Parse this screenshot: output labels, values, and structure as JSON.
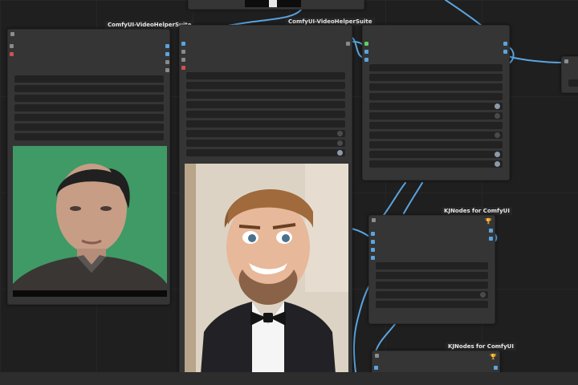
{
  "app": {
    "name": "ComfyUI"
  },
  "nodes": {
    "video_combine_a": {
      "badge": "ComfyUI-VideoHelperSuite"
    },
    "video_combine_b": {
      "badge": "ComfyUI-VideoHelperSuite"
    },
    "kjnodes_a": {
      "badge": "KJNodes for ComfyUI",
      "trophy": "🏆"
    },
    "kjnodes_b": {
      "badge": "KJNodes for ComfyUI",
      "trophy": "🏆"
    }
  },
  "colors": {
    "canvas": "#1f1f1f",
    "node_body": "#353535",
    "link": "#5aa4e0",
    "slot_image": "#5aa4e0",
    "slot_mask": "#d05050",
    "slot_latent": "#5fcf5f",
    "preview_green": "#3f9a66"
  }
}
